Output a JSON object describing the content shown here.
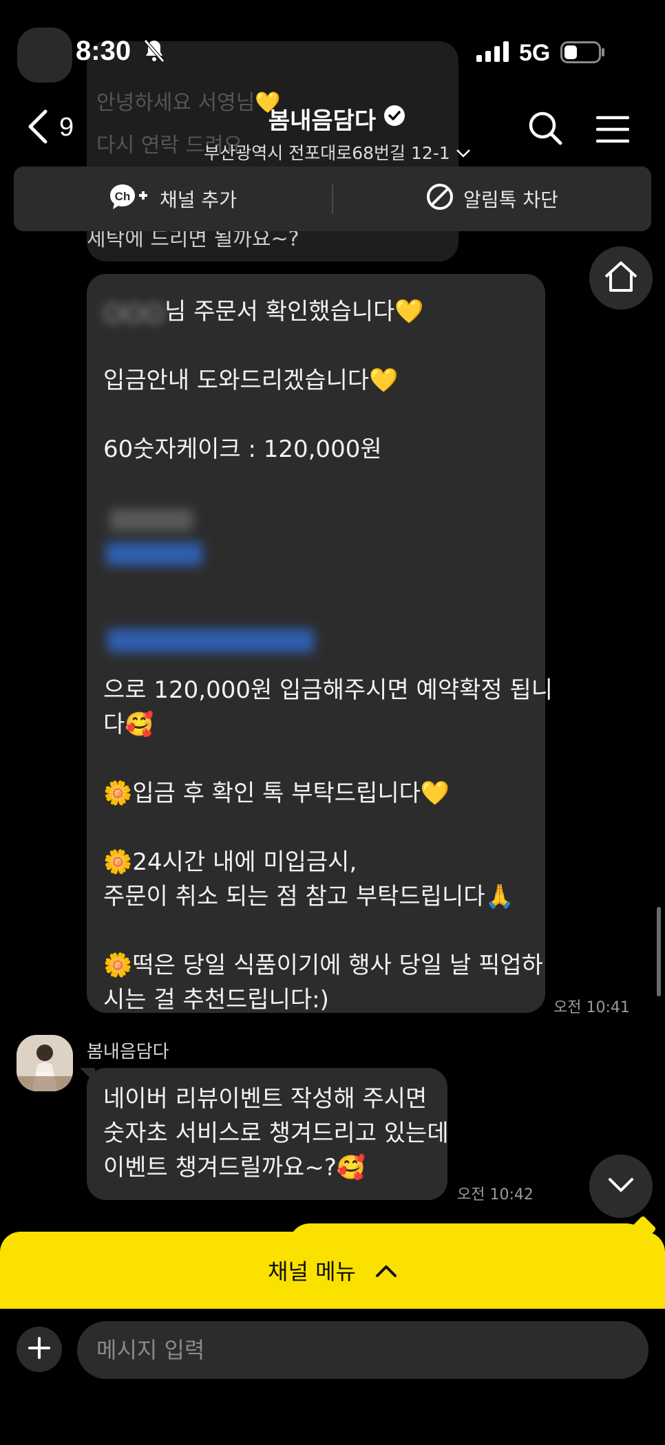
{
  "status": {
    "time": "8:30",
    "network": "5G"
  },
  "header": {
    "back_count": "9",
    "title": "봄내음담다",
    "address": "부산광역시 전포대로68번길 12-1"
  },
  "channel_bar": {
    "add_label": "채널 추가",
    "block_label": "알림톡 차단"
  },
  "background_messages": {
    "line1": "안녕하세요 서영님💛",
    "line2": "다시 연락 드려요",
    "cut_line": "세탁에 드리면 될까요~?"
  },
  "message1": {
    "lines": [
      {
        "text": "님 주문서 확인했습니다💛",
        "blur_prefix": "○○○"
      },
      {
        "text": ""
      },
      {
        "text": "입금안내 도와드리겠습니다💛"
      },
      {
        "text": ""
      },
      {
        "text": "60숫자케이크 : 120,000원"
      },
      {
        "text": ""
      },
      {
        "text": ""
      },
      {
        "text": ""
      },
      {
        "text": ""
      },
      {
        "text": ""
      },
      {
        "text": "으로 120,000원 입금해주시면 예약확정 됩니"
      },
      {
        "text": "다🥰"
      },
      {
        "text": ""
      },
      {
        "text": "🌼입금 후 확인 톡 부탁드립니다💛"
      },
      {
        "text": ""
      },
      {
        "text": "🌼24시간 내에 미입금시,"
      },
      {
        "text": "주문이 취소 되는 점 참고 부탁드립니다🙏"
      },
      {
        "text": ""
      },
      {
        "text": "🌼떡은 당일 식품이기에 행사 당일 날 픽업하"
      },
      {
        "text": "시는 걸 추천드립니다:)"
      }
    ],
    "time": "오전 10:41"
  },
  "message2": {
    "sender": "봄내음담다",
    "lines": [
      "네이버 리뷰이벤트 작성해 주시면",
      "숫자초 서비스로 챙겨드리고 있는데",
      "이벤트 챙겨드릴까요~?🥰"
    ],
    "time": "오전 10:42"
  },
  "channel_menu": {
    "label": "채널 메뉴"
  },
  "composer": {
    "placeholder": "메시지 입력"
  },
  "colors": {
    "accent": "#fae100",
    "bubble": "#2c2c2c",
    "background": "#000000"
  }
}
